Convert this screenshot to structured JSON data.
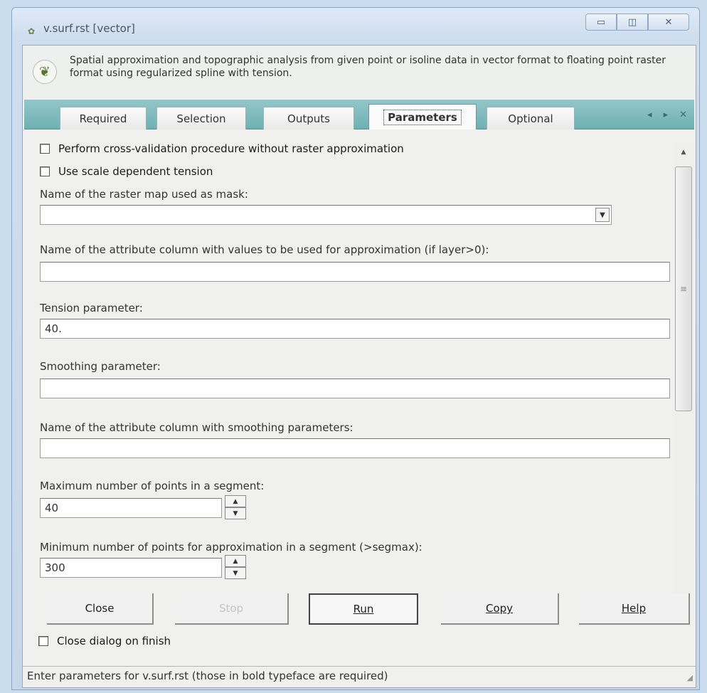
{
  "window": {
    "title": "v.surf.rst [vector]",
    "buttons": {
      "minimize": "▭",
      "maximize": "◫",
      "close": "✕"
    }
  },
  "header": {
    "description": "Spatial approximation and topographic analysis from given point or isoline data in vector format to floating point raster format using regularized spline with tension."
  },
  "tabs": [
    {
      "label": "Required",
      "active": false
    },
    {
      "label": "Selection",
      "active": false
    },
    {
      "label": "Outputs",
      "active": false
    },
    {
      "label": "Parameters",
      "active": true
    },
    {
      "label": "Optional",
      "active": false
    }
  ],
  "tab_nav": {
    "prev": "◂",
    "next": "▸",
    "close": "✕"
  },
  "parameters": {
    "checkbox_crossvalidation": "Perform cross-validation procedure without raster approximation",
    "checkbox_scale_tension": "Use scale dependent tension",
    "mask_label": "Name of the raster map used as mask:",
    "mask_value": "",
    "zcolumn_label": "Name of the attribute column with values to be used for approximation (if layer>0):",
    "zcolumn_value": "",
    "tension_label": "Tension parameter:",
    "tension_value": "40.",
    "smooth_label": "Smoothing parameter:",
    "smooth_value": "",
    "scolumn_label": "Name of the attribute column with smoothing parameters:",
    "scolumn_value": "",
    "segmax_label": "Maximum number of points in a segment:",
    "segmax_value": "40",
    "npmin_label": "Minimum number of points for approximation in a segment (>segmax):",
    "npmin_value": "300"
  },
  "buttons": {
    "close": "Close",
    "stop": "Stop",
    "run": "Run",
    "copy": "Copy",
    "help": "Help"
  },
  "close_on_finish": "Close dialog on finish",
  "status": "Enter parameters for v.surf.rst (those in bold typeface are required)"
}
